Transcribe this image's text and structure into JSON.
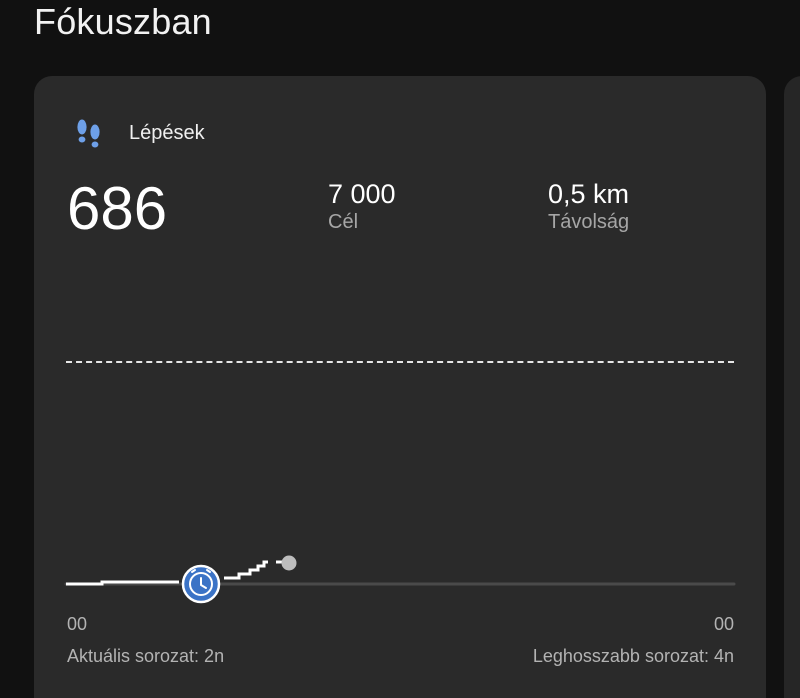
{
  "section": {
    "title": "Fókuszban"
  },
  "card": {
    "title": "Lépések",
    "icon": "footsteps-icon",
    "steps_value": "686",
    "goal": {
      "value": "7 000",
      "label": "Cél"
    },
    "distance": {
      "value": "0,5 km",
      "label": "Távolság"
    },
    "axis": {
      "start": "00",
      "end": "00"
    },
    "streak": {
      "current": "Aktuális sorozat: 2n",
      "longest": "Leghosszabb sorozat: 4n"
    },
    "colors": {
      "accent": "#3b73c6",
      "icon": "#6ea0e8",
      "line": "#ffffff",
      "track": "#4a4a4a",
      "marker_end": "#bdbdbd"
    }
  }
}
